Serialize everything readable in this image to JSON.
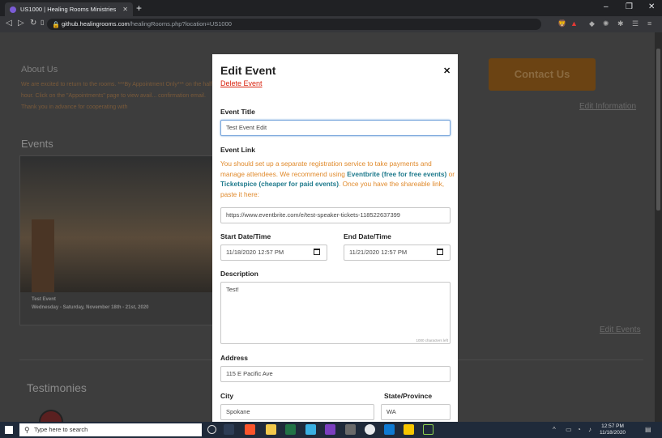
{
  "browser": {
    "tab_title": "US1000 | Healing Rooms Ministries",
    "url_host": "github.healingrooms.com",
    "url_path": "/healingRooms.php?location=US1000"
  },
  "background": {
    "about_heading": "About Us",
    "about_text": "We are excited to return to the rooms. ***By Appointment Only*** on the half hour. Click on the \"Appointments\" page to view avail... confirmation email. Thank you in advance for cooperating with",
    "contact_label": "Contact Us",
    "edit_information": "Edit Information",
    "events_heading": "Events",
    "event_title": "Test Event",
    "event_date": "Wednesday - Saturday, November 18th - 21st, 2020",
    "edit_events": "Edit Events",
    "testimonies_heading": "Testimonies"
  },
  "modal": {
    "title": "Edit Event",
    "close_icon": "close-icon",
    "delete_label": "Delete Event",
    "event_title_label": "Event Title",
    "event_title_value": "Test Event Edit",
    "event_link_label": "Event Link",
    "info_part1": "You should set up a separate registration service to take payments and manage attendees. We recommend using ",
    "info_link1": "Eventbrite (free for free events)",
    "info_or": " or ",
    "info_link2": "Ticketspice (cheaper for paid events)",
    "info_part2": ". Once you have the shareable link, paste it here:",
    "event_link_value": "https://www.eventbrite.com/e/test-speaker-tickets-118522637399",
    "start_label": "Start Date/Time",
    "start_value": "11/18/2020 12:57 PM",
    "end_label": "End Date/Time",
    "end_value": "11/21/2020 12:57 PM",
    "description_label": "Description",
    "description_value": "Test!",
    "char_counter": "1000 characters left",
    "address_label": "Address",
    "address_value": "115 E Pacific Ave",
    "city_label": "City",
    "city_value": "Spokane",
    "state_label": "State/Province",
    "state_value": "WA"
  },
  "taskbar": {
    "search_placeholder": "Type here to search",
    "time": "12:57 PM",
    "date": "11/18/2020"
  }
}
